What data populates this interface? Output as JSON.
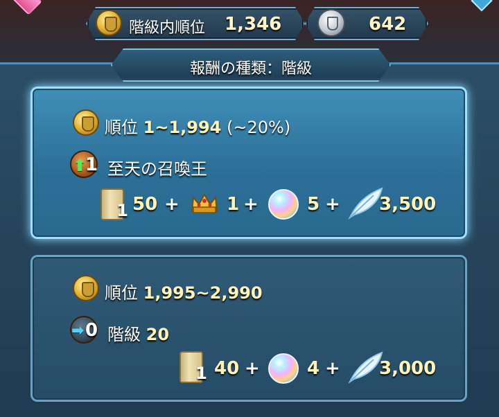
{
  "top_bar": {
    "rank_label": "階級内順位",
    "rank_value": "1,346",
    "score_value": "642"
  },
  "header": {
    "title": "報酬の種類：階級"
  },
  "cards": [
    {
      "rank_label": "順位",
      "rank_range": "1~1,994",
      "rank_percent": "(~20%)",
      "tier_change": "1",
      "tier_text": "至天の召喚王",
      "rewards": [
        {
          "icon": "scroll-icon",
          "count": "1",
          "value": "50"
        },
        {
          "icon": "crown-icon",
          "value": "1"
        },
        {
          "icon": "orb-icon",
          "value": "5"
        },
        {
          "icon": "feather-icon",
          "value": "3,500"
        }
      ]
    },
    {
      "rank_label": "順位",
      "rank_range": "1,995~2,990",
      "tier_change": "0",
      "tier_label": "階級",
      "tier_value": "20",
      "rewards": [
        {
          "icon": "scroll-icon",
          "count": "1",
          "value": "40"
        },
        {
          "icon": "orb-icon",
          "value": "4"
        },
        {
          "icon": "feather-icon",
          "value": "3,000"
        }
      ]
    }
  ],
  "plus_sign": "+"
}
